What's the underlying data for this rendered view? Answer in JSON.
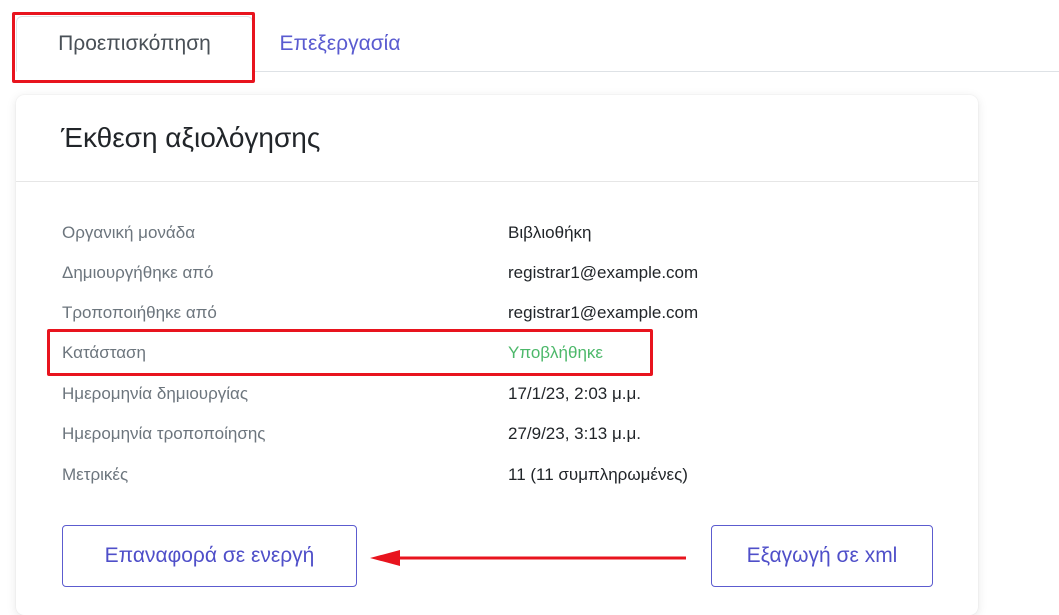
{
  "tabs": [
    {
      "label": "Προεπισκόπηση",
      "active": true
    },
    {
      "label": "Επεξεργασία",
      "active": false
    }
  ],
  "card": {
    "title": "Έκθεση αξιολόγησης",
    "fields": [
      {
        "label": "Οργανική μονάδα",
        "value": "Βιβλιοθήκη"
      },
      {
        "label": "Δημιουργήθηκε από",
        "value": "registrar1@example.com"
      },
      {
        "label": "Τροποποιήθηκε από",
        "value": "registrar1@example.com"
      },
      {
        "label": "Κατάσταση",
        "value": "Υποβλήθηκε"
      },
      {
        "label": "Ημερομηνία δημιουργίας",
        "value": "17/1/23, 2:03 μ.μ."
      },
      {
        "label": "Ημερομηνία τροποποίησης",
        "value": "27/9/23, 3:13 μ.μ."
      },
      {
        "label": "Μετρικές",
        "value": "11 (11 συμπληρωμένες)"
      }
    ]
  },
  "actions": {
    "reset_label": "Επαναφορά σε ενεργή",
    "export_label": "Εξαγωγή σε xml"
  },
  "colors": {
    "accent": "#5c5ccf",
    "status_ok": "#4cb86a",
    "annotation": "#e8141e"
  }
}
